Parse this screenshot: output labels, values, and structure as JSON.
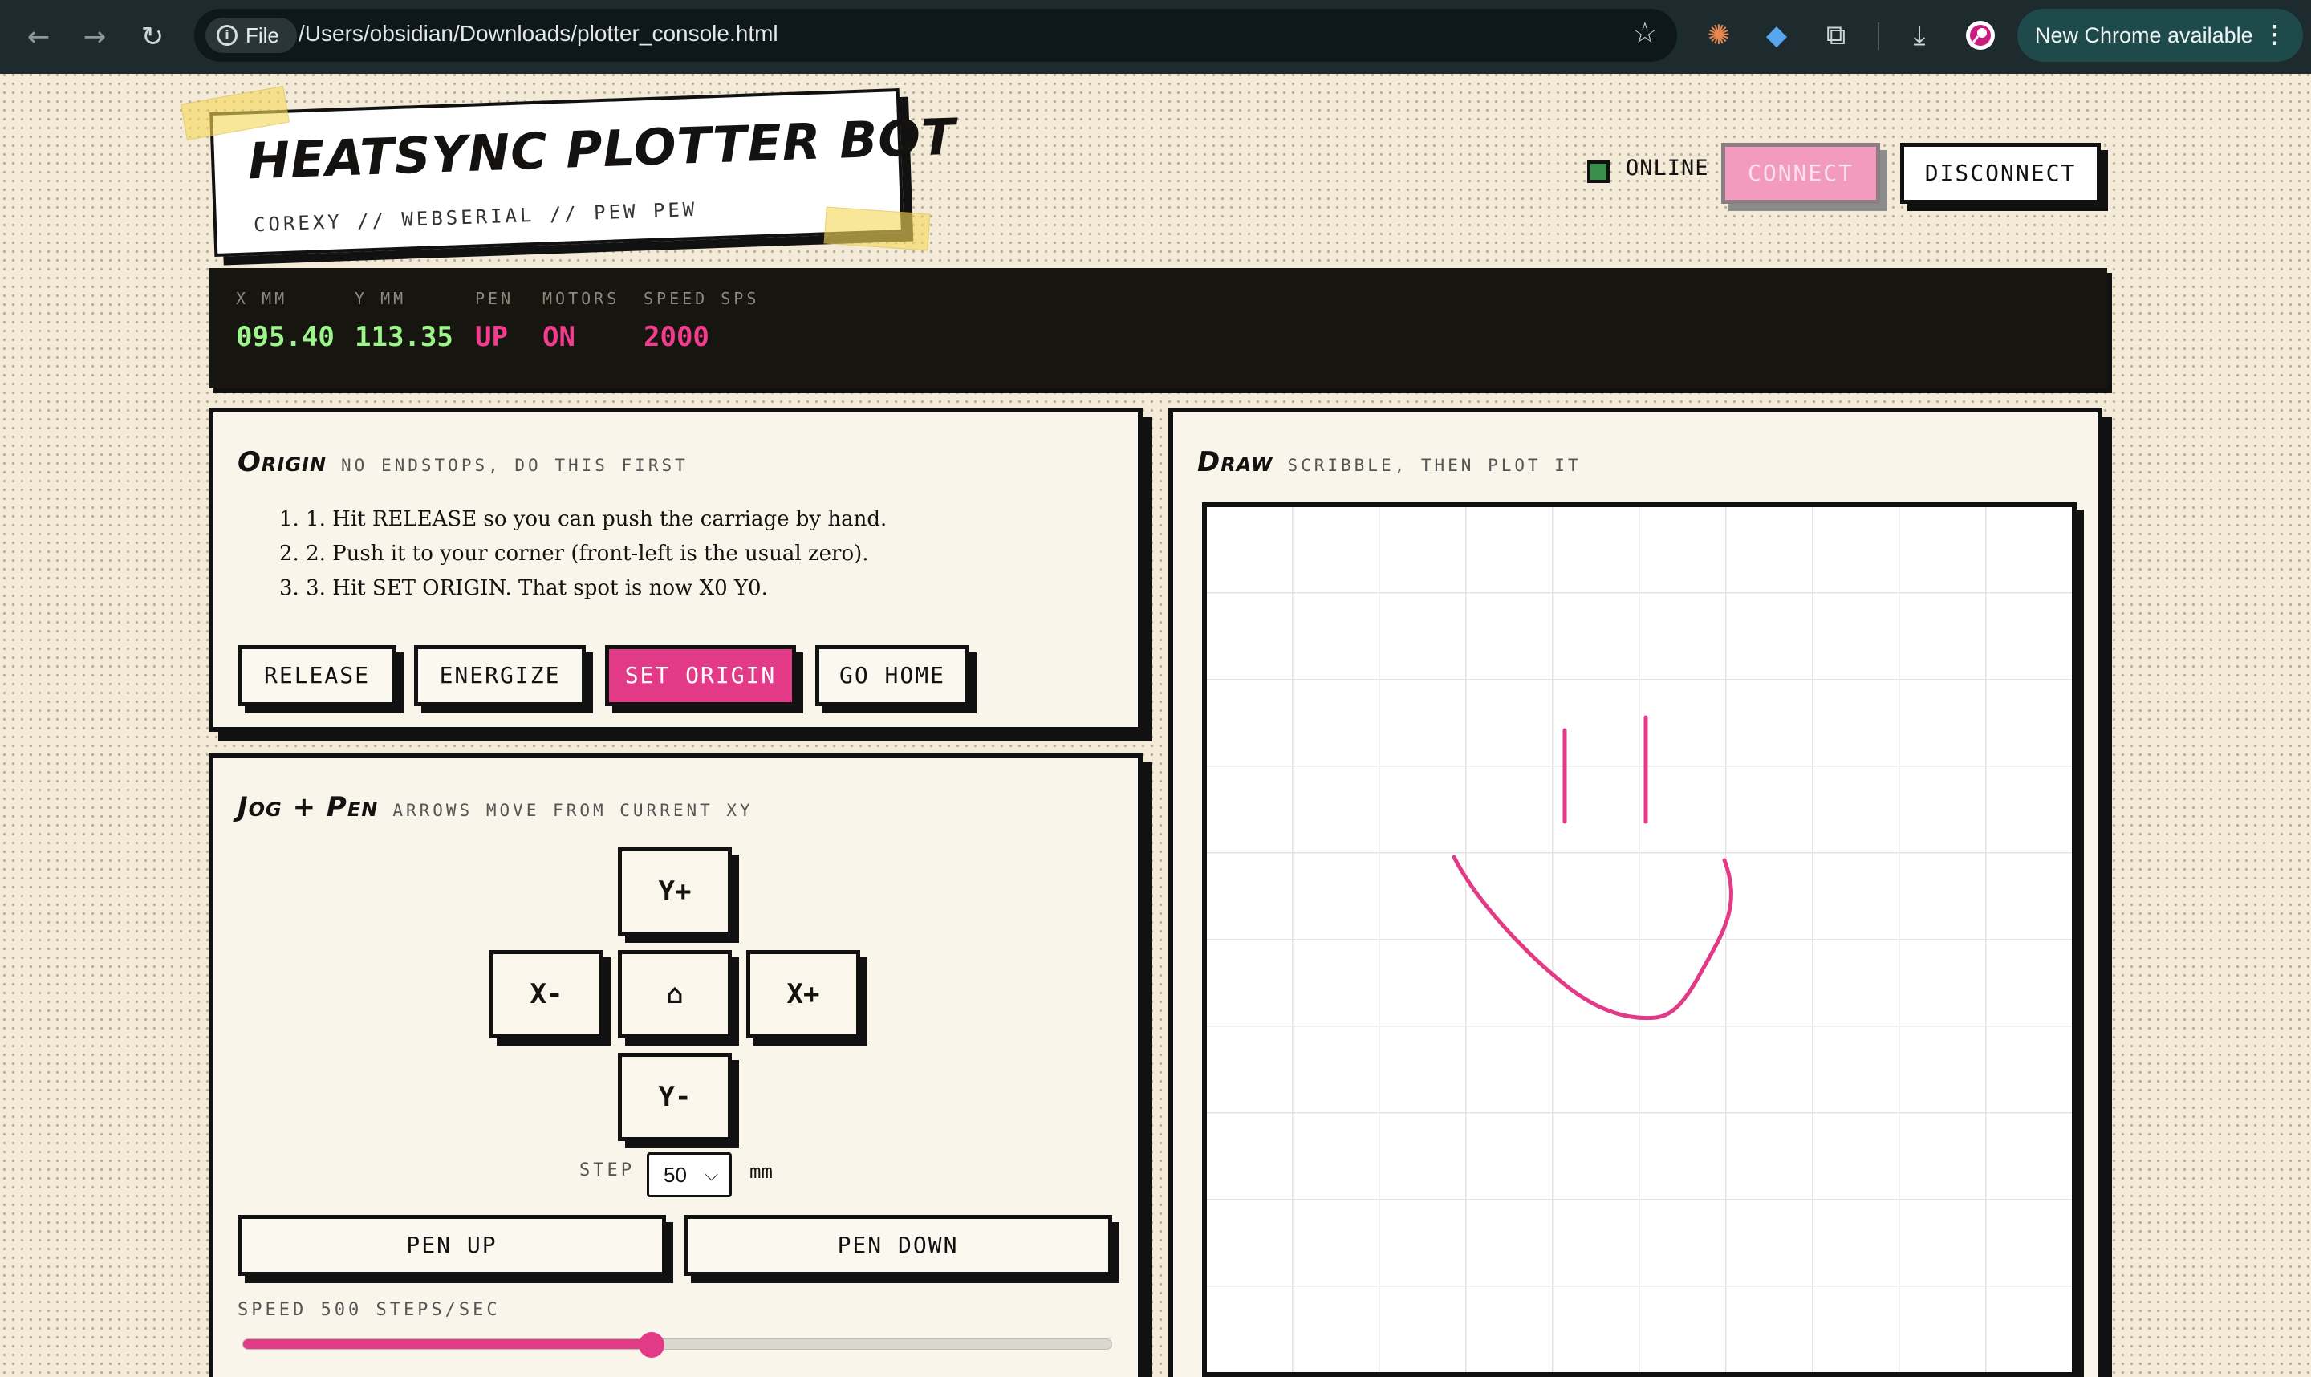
{
  "browser": {
    "chip_label": "File",
    "url": "/Users/obsidian/Downloads/plotter_console.html",
    "update_label": "New Chrome available"
  },
  "header": {
    "title": "HEATSYNC PLOTTER BOT",
    "subtitle": "COREXY // WEBSERIAL // PEW PEW",
    "status": "ONLINE",
    "connect_label": "CONNECT",
    "disconnect_label": "DISCONNECT"
  },
  "telemetry": [
    {
      "label": "X MM",
      "value": "095.40",
      "color": "#9cf58a"
    },
    {
      "label": "Y MM",
      "value": "113.35",
      "color": "#9cf58a"
    },
    {
      "label": "PEN",
      "value": "UP",
      "color": "#f23c8e"
    },
    {
      "label": "MOTORS",
      "value": "ON",
      "color": "#f23c8e"
    },
    {
      "label": "SPEED SPS",
      "value": "2000",
      "color": "#f23c8e"
    }
  ],
  "origin": {
    "title": "Origin",
    "subtitle": "NO ENDSTOPS, DO THIS FIRST",
    "steps": [
      "1. 1. Hit RELEASE so you can push the carriage by hand.",
      "2. 2. Push it to your corner (front-left is the usual zero).",
      "3. 3. Hit SET ORIGIN. That spot is now X0 Y0."
    ],
    "buttons": [
      "RELEASE",
      "ENERGIZE",
      "SET ORIGIN",
      "GO HOME"
    ]
  },
  "jog": {
    "title": "Jog + Pen",
    "subtitle": "ARROWS MOVE FROM CURRENT XY",
    "y_plus": "Y+",
    "x_minus": "X-",
    "home": "⌂",
    "x_plus": "X+",
    "y_minus": "Y-",
    "step_label": "STEP",
    "step_value": "50",
    "step_unit": "mm",
    "pen_up": "PEN UP",
    "pen_down": "PEN DOWN",
    "speed_label": "SPEED 500 STEPS/SEC",
    "speed_fraction": 0.47
  },
  "draw": {
    "title": "Draw",
    "subtitle": "SCRIBBLE, THEN PLOT IT",
    "stroke_color": "#e23a86"
  },
  "colors": {
    "accent": "#e23a86",
    "ink": "#111111",
    "paper": "#f3ead8",
    "online": "#3a8f4a"
  }
}
